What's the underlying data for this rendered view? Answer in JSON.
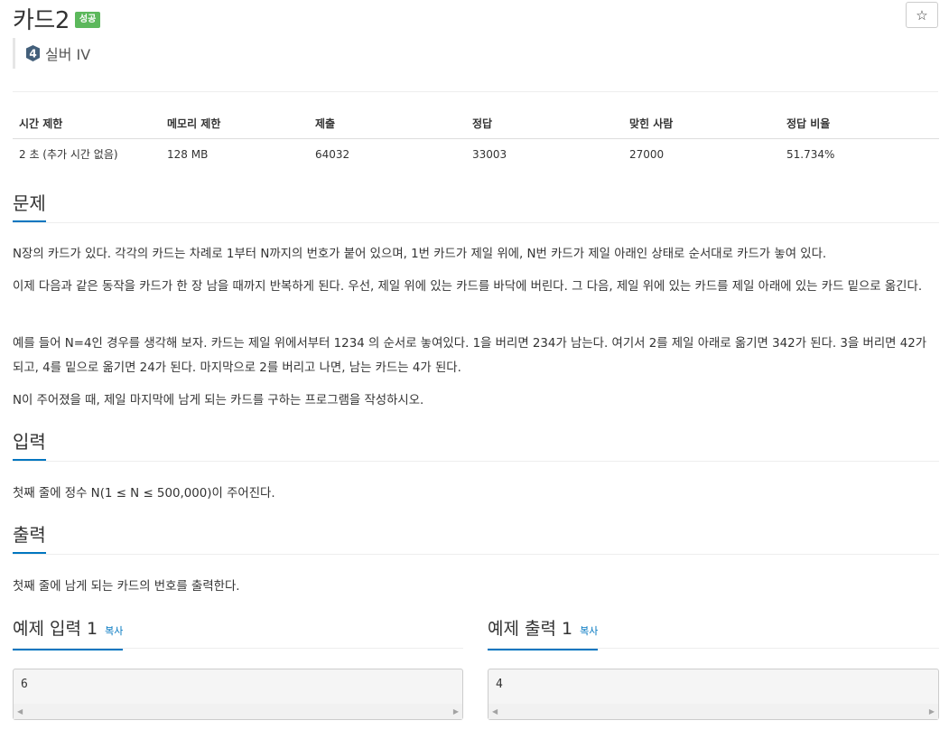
{
  "problem": {
    "title": "카드2",
    "status_badge": "성공",
    "star_icon": "☆",
    "tier_number": "4",
    "tier_label": "실버 IV",
    "tier_color": "#435f7a"
  },
  "stats": {
    "headers": [
      "시간 제한",
      "메모리 제한",
      "제출",
      "정답",
      "맞힌 사람",
      "정답 비율"
    ],
    "values": [
      "2 초 (추가 시간 없음)",
      "128 MB",
      "64032",
      "33003",
      "27000",
      "51.734%"
    ]
  },
  "sections": {
    "description": {
      "heading": "문제",
      "paragraphs": [
        "N장의 카드가 있다. 각각의 카드는 차례로 1부터 N까지의 번호가 붙어 있으며, 1번 카드가 제일 위에, N번 카드가 제일 아래인 상태로 순서대로 카드가 놓여 있다.",
        "이제 다음과 같은 동작을 카드가 한 장 남을 때까지 반복하게 된다. 우선, 제일 위에 있는 카드를 바닥에 버린다. 그 다음, 제일 위에 있는 카드를 제일 아래에 있는 카드 밑으로 옮긴다.",
        "예를 들어 N=4인 경우를 생각해 보자. 카드는 제일 위에서부터 1234 의 순서로 놓여있다. 1을 버리면 234가 남는다. 여기서 2를 제일 아래로 옮기면 342가 된다. 3을 버리면 42가 되고, 4를 밑으로 옮기면 24가 된다. 마지막으로 2를 버리고 나면, 남는 카드는 4가 된다.",
        "N이 주어졌을 때, 제일 마지막에 남게 되는 카드를 구하는 프로그램을 작성하시오."
      ]
    },
    "input": {
      "heading": "입력",
      "text": "첫째 줄에 정수 N(1 ≤ N ≤ 500,000)이 주어진다."
    },
    "output": {
      "heading": "출력",
      "text": "첫째 줄에 남게 되는 카드의 번호를 출력한다."
    }
  },
  "samples": {
    "input": {
      "heading": "예제 입력 1",
      "copy_label": "복사",
      "value": "6"
    },
    "output": {
      "heading": "예제 출력 1",
      "copy_label": "복사",
      "value": "4"
    }
  },
  "colors": {
    "accent": "#0076c0",
    "success": "#5cb85c"
  }
}
